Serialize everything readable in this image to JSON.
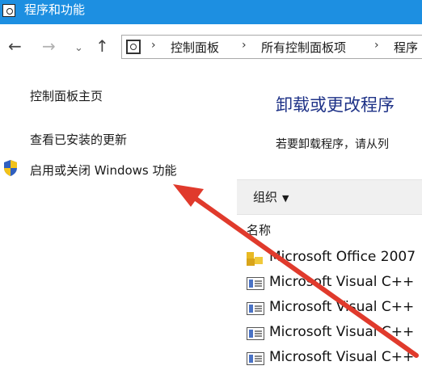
{
  "window": {
    "title": "程序和功能",
    "app_icon": "control-panel-icon"
  },
  "nav": {
    "back": "←",
    "forward": "→",
    "recent": "⌄",
    "up": "↑"
  },
  "address": {
    "icon": "control-panel-icon",
    "separator": "›",
    "crumbs": [
      "控制面板",
      "所有控制面板项",
      "程序"
    ]
  },
  "sidebar": {
    "home": "控制面板主页",
    "updates": "查看已安装的更新",
    "features": "启用或关闭 Windows 功能",
    "features_icon": "uac-shield-icon"
  },
  "main": {
    "title": "卸载或更改程序",
    "description": "若要卸载程序，请从列",
    "organize": "组织",
    "organize_caret": "▼",
    "column_name": "名称",
    "programs": [
      {
        "name": "Microsoft Office 2007",
        "icon": "office-icon"
      },
      {
        "name": "Microsoft Visual C++",
        "icon": "installer-icon"
      },
      {
        "name": "Microsoft Visual C++",
        "icon": "installer-icon"
      },
      {
        "name": "Microsoft Visual C++",
        "icon": "installer-icon"
      },
      {
        "name": "Microsoft Visual C++",
        "icon": "installer-icon"
      }
    ]
  },
  "annotation": {
    "color": "#e03a2c"
  },
  "colors": {
    "titlebar": "#1d8fe1",
    "heading": "#1e3287"
  }
}
